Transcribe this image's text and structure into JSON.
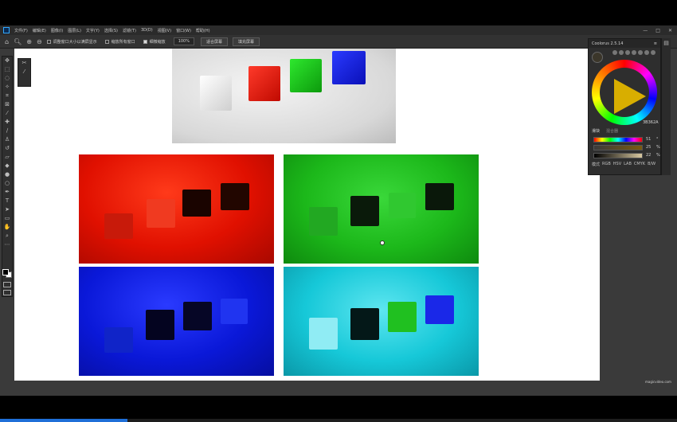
{
  "menubar": {
    "items": [
      "文件(F)",
      "编辑(E)",
      "图像(I)",
      "图层(L)",
      "文字(Y)",
      "选择(S)",
      "滤镜(T)",
      "3D(D)",
      "视图(V)",
      "窗口(W)",
      "帮助(H)"
    ]
  },
  "options_bar": {
    "check_resize": "调整窗口大小以满屏显示",
    "check_zoom_all": "缩放所有窗口",
    "check_scrubby": "细微缩放",
    "zoom_value": "100%",
    "btn_fit": "适合屏幕",
    "btn_fill": "填充屏幕"
  },
  "coolorus": {
    "title": "Coolorus 2.5.14",
    "tab_active": "滑块",
    "tab_inactive": "混合器",
    "hex": "3B362A",
    "slider_values": [
      "51",
      "25",
      "22"
    ],
    "slider_units": [
      "°",
      "%",
      "%"
    ],
    "modes": [
      "模式",
      "RGB",
      "HSV",
      "LAB",
      "CMYK",
      "B/W"
    ]
  },
  "watermark": "magicvideo.com",
  "colors": {
    "red_bg": "#e01000",
    "green_bg": "#1cb81a",
    "blue_bg": "#0a18d8",
    "cyan_bg": "#16c8d8"
  }
}
